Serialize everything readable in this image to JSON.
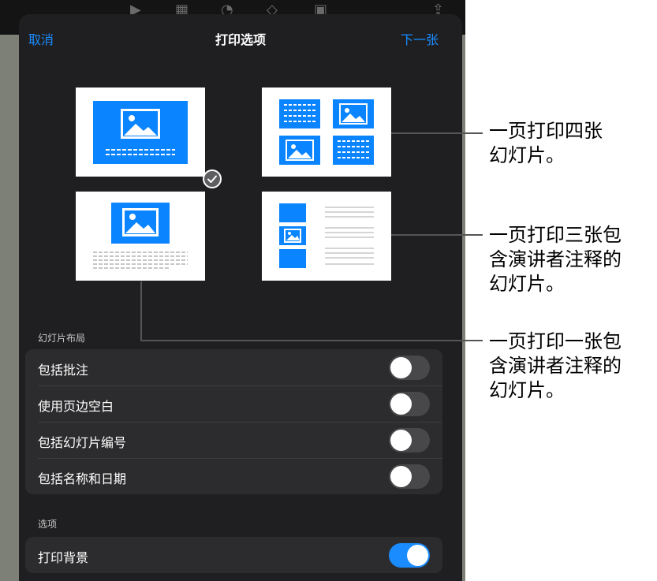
{
  "sheet": {
    "title": "打印选项",
    "cancel_label": "取消",
    "next_label": "下一张"
  },
  "layouts": [
    {
      "name": "one-slide",
      "selected": true
    },
    {
      "name": "four-slides",
      "selected": false
    },
    {
      "name": "one-slide-with-notes",
      "selected": false
    },
    {
      "name": "three-slides-with-notes",
      "selected": false
    }
  ],
  "slide_layout_section": {
    "header": "幻灯片布局",
    "rows": [
      {
        "label": "包括批注",
        "on": false
      },
      {
        "label": "使用页边空白",
        "on": false
      },
      {
        "label": "包括幻灯片编号",
        "on": false
      },
      {
        "label": "包括名称和日期",
        "on": false
      }
    ]
  },
  "options_section": {
    "header": "选项",
    "rows": [
      {
        "label": "打印背景",
        "on": true
      }
    ]
  },
  "callouts": {
    "four": [
      "一页打印四张",
      "幻灯片。"
    ],
    "three_notes": [
      "一页打印三张包",
      "含演讲者注释的",
      "幻灯片。"
    ],
    "one_notes": [
      "一页打印一张包",
      "含演讲者注释的",
      "幻灯片。"
    ]
  },
  "colors": {
    "accent": "#1a8cff",
    "slide_blue": "#0a84ff",
    "sheet": "#1f1f21",
    "group": "#2c2c2e"
  }
}
